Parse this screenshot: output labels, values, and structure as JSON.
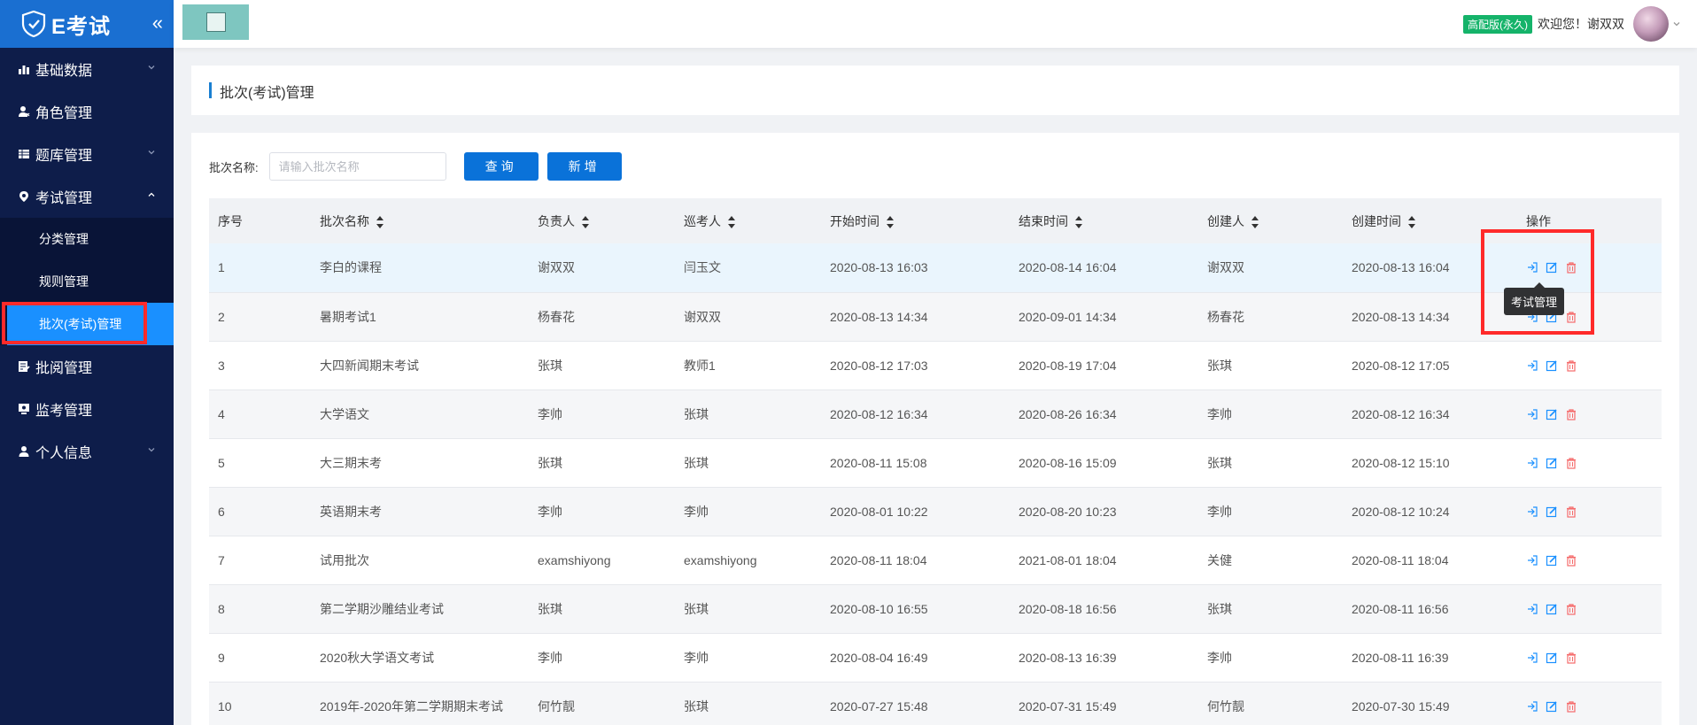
{
  "app": {
    "logo_text": "E考试"
  },
  "sidebar": {
    "items": [
      {
        "label": "基础数据",
        "icon": "bar-chart-icon",
        "expandable": true,
        "expanded": false
      },
      {
        "label": "角色管理",
        "icon": "user-group-icon",
        "expandable": false
      },
      {
        "label": "题库管理",
        "icon": "table-icon",
        "expandable": true,
        "expanded": false
      },
      {
        "label": "考试管理",
        "icon": "location-pin-icon",
        "expandable": true,
        "expanded": true,
        "children": [
          {
            "label": "分类管理",
            "active": false
          },
          {
            "label": "规则管理",
            "active": false
          },
          {
            "label": "批次(考试)管理",
            "active": true
          }
        ]
      },
      {
        "label": "批阅管理",
        "icon": "document-edit-icon",
        "expandable": false
      },
      {
        "label": "监考管理",
        "icon": "monitor-icon",
        "expandable": false
      },
      {
        "label": "个人信息",
        "icon": "user-icon",
        "expandable": true,
        "expanded": false
      }
    ]
  },
  "header": {
    "badge": "高配版(永久)",
    "greeting": "欢迎您！谢双双"
  },
  "page": {
    "title": "批次(考试)管理"
  },
  "search": {
    "label": "批次名称:",
    "placeholder": "请输入批次名称",
    "value": "",
    "query_label": "查询",
    "add_label": "新增"
  },
  "table": {
    "columns": [
      "序号",
      "批次名称",
      "负责人",
      "巡考人",
      "开始时间",
      "结束时间",
      "创建人",
      "创建时间",
      "操作"
    ],
    "sortable": [
      false,
      true,
      true,
      true,
      true,
      true,
      true,
      true,
      false
    ],
    "rows": [
      [
        "1",
        "李白的课程",
        "谢双双",
        "闫玉文",
        "2020-08-13 16:03",
        "2020-08-14 16:04",
        "谢双双",
        "2020-08-13 16:04"
      ],
      [
        "2",
        "暑期考试1",
        "杨春花",
        "谢双双",
        "2020-08-13 14:34",
        "2020-09-01 14:34",
        "杨春花",
        "2020-08-13 14:34"
      ],
      [
        "3",
        "大四新闻期末考试",
        "张琪",
        "教师1",
        "2020-08-12 17:03",
        "2020-08-19 17:04",
        "张琪",
        "2020-08-12 17:05"
      ],
      [
        "4",
        "大学语文",
        "李帅",
        "张琪",
        "2020-08-12 16:34",
        "2020-08-26 16:34",
        "李帅",
        "2020-08-12 16:34"
      ],
      [
        "5",
        "大三期末考",
        "张琪",
        "张琪",
        "2020-08-11 15:08",
        "2020-08-16 15:09",
        "张琪",
        "2020-08-12 15:10"
      ],
      [
        "6",
        "英语期末考",
        "李帅",
        "李帅",
        "2020-08-01 10:22",
        "2020-08-20 10:23",
        "李帅",
        "2020-08-12 10:24"
      ],
      [
        "7",
        "试用批次",
        "examshiyong",
        "examshiyong",
        "2020-08-11 18:04",
        "2021-08-01 18:04",
        "关健",
        "2020-08-11 18:04"
      ],
      [
        "8",
        "第二学期沙雕结业考试",
        "张琪",
        "张琪",
        "2020-08-10 16:55",
        "2020-08-18 16:56",
        "张琪",
        "2020-08-11 16:56"
      ],
      [
        "9",
        "2020秋大学语文考试",
        "李帅",
        "李帅",
        "2020-08-04 16:49",
        "2020-08-13 16:39",
        "李帅",
        "2020-08-11 16:39"
      ],
      [
        "10",
        "2019年-2020年第二学期期末考试",
        "何竹靓",
        "张琪",
        "2020-07-27 15:48",
        "2020-07-31 15:49",
        "何竹靓",
        "2020-07-30 15:49"
      ]
    ]
  },
  "tooltip": {
    "text": "考试管理"
  },
  "colors": {
    "sidebar_bg": "#0e1d4a",
    "logo_bar": "#1a6fd1",
    "active_item": "#1a90ff",
    "primary_button": "#0a72d9",
    "badge_green": "#15b36a",
    "highlight_red": "#ff2a2a",
    "op_blue": "#1a90ff",
    "op_red": "#f56c6c"
  }
}
